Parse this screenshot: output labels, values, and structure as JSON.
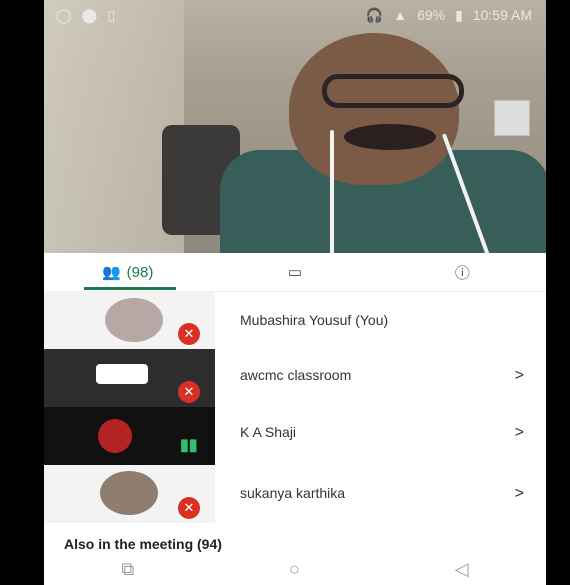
{
  "status_bar": {
    "left_icons": [
      "whatsapp-icon",
      "location-icon",
      "sim-icon"
    ],
    "signal_text": "69%",
    "time": "10:59 AM"
  },
  "tabs": [
    {
      "label": "(98)",
      "icon": "people-icon",
      "active": true
    },
    {
      "label": "",
      "icon": "chat-icon",
      "active": false
    },
    {
      "label": "",
      "icon": "info-icon",
      "active": false
    }
  ],
  "participants": [
    {
      "name": "Mubashira Yousuf (You)",
      "avatar": "photo",
      "muted": true,
      "has_chevron": false
    },
    {
      "name": "awcmc classroom",
      "avatar": "screen-share",
      "muted": true,
      "has_chevron": true
    },
    {
      "name": "K A Shaji",
      "avatar": "presenter",
      "muted": false,
      "has_chevron": true
    },
    {
      "name": "sukanya karthika",
      "avatar": "photo",
      "muted": true,
      "has_chevron": true
    }
  ],
  "also_in_meeting": "Also in the meeting (94)",
  "nav": [
    "recent-apps-icon",
    "home-icon",
    "back-icon"
  ],
  "chevron": ">"
}
